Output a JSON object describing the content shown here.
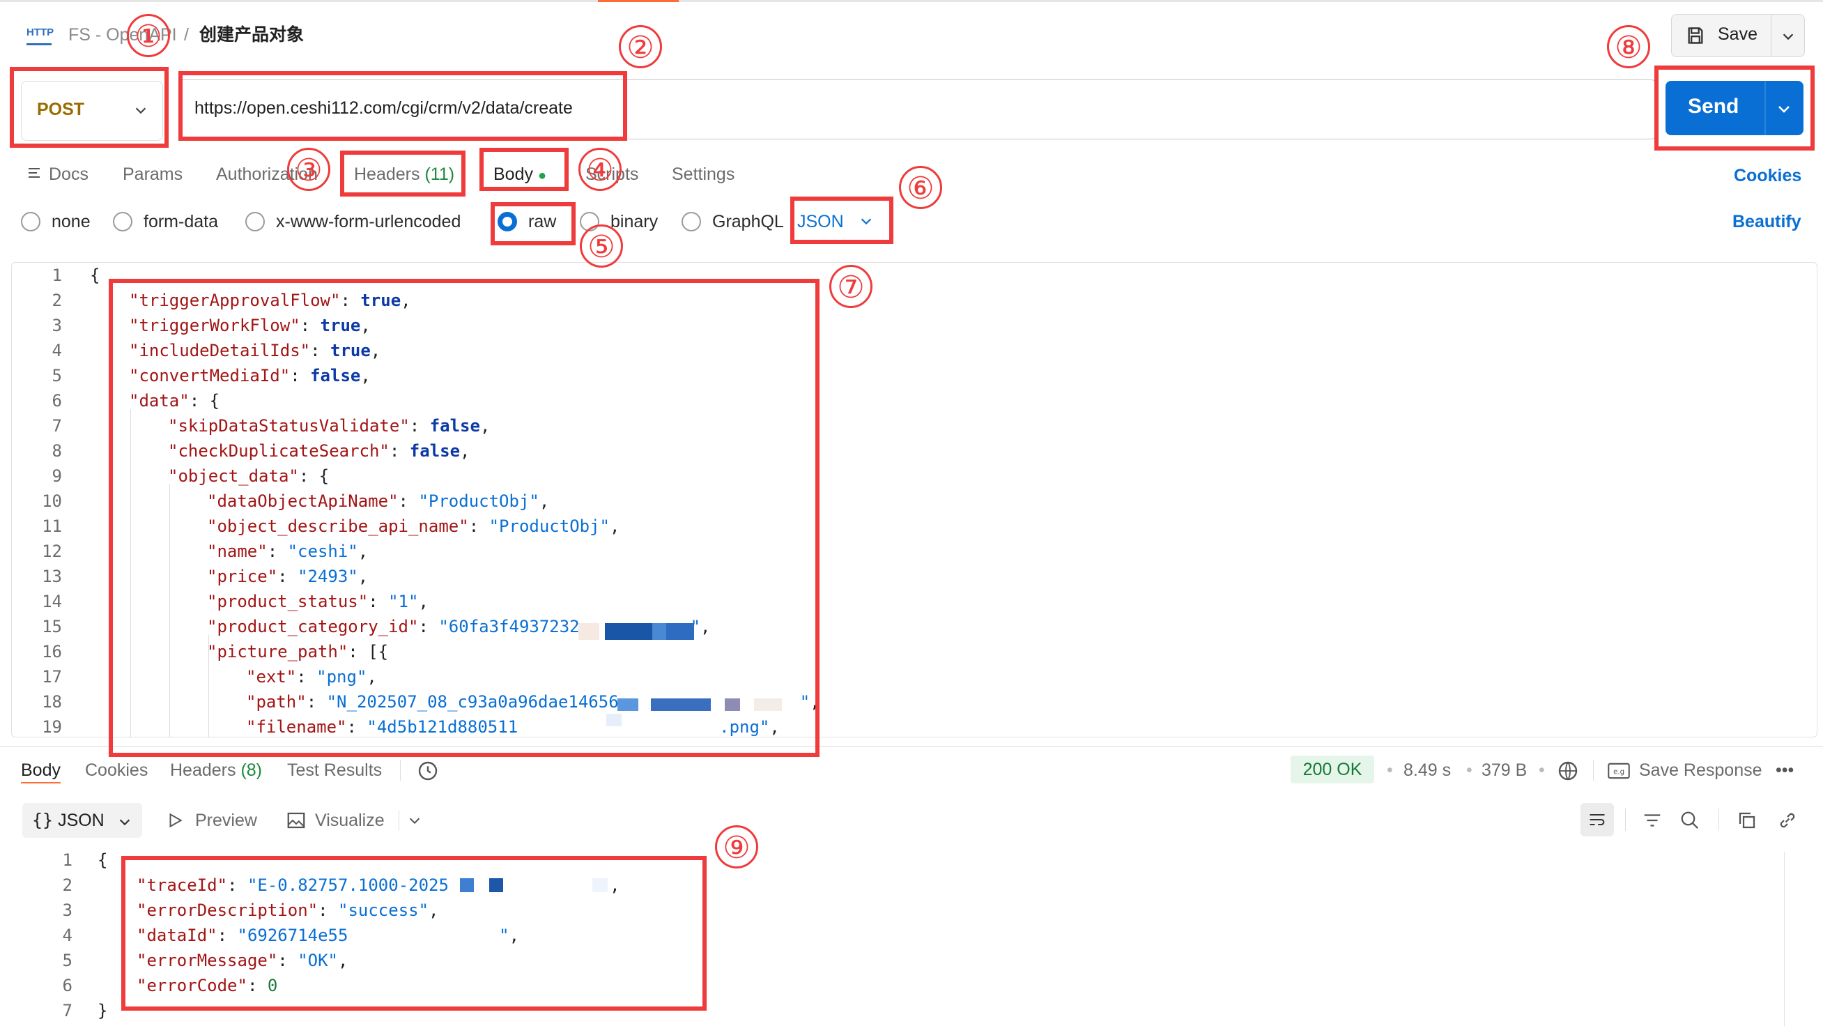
{
  "breadcrumb": {
    "collection": "FS - OpenAPI",
    "separator": "/",
    "request": "创建产品对象"
  },
  "toolbar": {
    "save_label": "Save"
  },
  "request": {
    "method": "POST",
    "url": "https://open.ceshi112.com/cgi/crm/v2/data/create",
    "send_label": "Send"
  },
  "tabs": {
    "docs": "Docs",
    "params": "Params",
    "authorization": "Authorization",
    "headers": "Headers",
    "headers_count": "(11)",
    "body": "Body",
    "scripts": "Scripts",
    "settings": "Settings",
    "cookies": "Cookies"
  },
  "body_modes": {
    "none": "none",
    "form_data": "form-data",
    "urlencoded": "x-www-form-urlencoded",
    "raw": "raw",
    "binary": "binary",
    "graphql": "GraphQL",
    "format": "JSON",
    "beautify": "Beautify"
  },
  "request_body_lines": [
    {
      "n": "1",
      "indent": 0,
      "t": [
        [
          "p",
          "{"
        ]
      ]
    },
    {
      "n": "2",
      "indent": 1,
      "t": [
        [
          "k",
          "\"triggerApprovalFlow\""
        ],
        [
          "p",
          ": "
        ],
        [
          "b",
          "true"
        ],
        [
          "p",
          ","
        ]
      ]
    },
    {
      "n": "3",
      "indent": 1,
      "t": [
        [
          "k",
          "\"triggerWorkFlow\""
        ],
        [
          "p",
          ": "
        ],
        [
          "b",
          "true"
        ],
        [
          "p",
          ","
        ]
      ]
    },
    {
      "n": "4",
      "indent": 1,
      "t": [
        [
          "k",
          "\"includeDetailIds\""
        ],
        [
          "p",
          ": "
        ],
        [
          "b",
          "true"
        ],
        [
          "p",
          ","
        ]
      ]
    },
    {
      "n": "5",
      "indent": 1,
      "t": [
        [
          "k",
          "\"convertMediaId\""
        ],
        [
          "p",
          ": "
        ],
        [
          "b",
          "false"
        ],
        [
          "p",
          ","
        ]
      ]
    },
    {
      "n": "6",
      "indent": 1,
      "t": [
        [
          "k",
          "\"data\""
        ],
        [
          "p",
          ": {"
        ]
      ]
    },
    {
      "n": "7",
      "indent": 2,
      "t": [
        [
          "k",
          "\"skipDataStatusValidate\""
        ],
        [
          "p",
          ": "
        ],
        [
          "b",
          "false"
        ],
        [
          "p",
          ","
        ]
      ]
    },
    {
      "n": "8",
      "indent": 2,
      "t": [
        [
          "k",
          "\"checkDuplicateSearch\""
        ],
        [
          "p",
          ": "
        ],
        [
          "b",
          "false"
        ],
        [
          "p",
          ","
        ]
      ]
    },
    {
      "n": "9",
      "indent": 2,
      "t": [
        [
          "k",
          "\"object_data\""
        ],
        [
          "p",
          ": {"
        ]
      ]
    },
    {
      "n": "10",
      "indent": 3,
      "t": [
        [
          "k",
          "\"dataObjectApiName\""
        ],
        [
          "p",
          ": "
        ],
        [
          "s",
          "\"ProductObj\""
        ],
        [
          "p",
          ","
        ]
      ]
    },
    {
      "n": "11",
      "indent": 3,
      "t": [
        [
          "k",
          "\"object_describe_api_name\""
        ],
        [
          "p",
          ": "
        ],
        [
          "s",
          "\"ProductObj\""
        ],
        [
          "p",
          ","
        ]
      ]
    },
    {
      "n": "12",
      "indent": 3,
      "t": [
        [
          "k",
          "\"name\""
        ],
        [
          "p",
          ": "
        ],
        [
          "s",
          "\"ceshi\""
        ],
        [
          "p",
          ","
        ]
      ]
    },
    {
      "n": "13",
      "indent": 3,
      "t": [
        [
          "k",
          "\"price\""
        ],
        [
          "p",
          ": "
        ],
        [
          "s",
          "\"2493\""
        ],
        [
          "p",
          ","
        ]
      ]
    },
    {
      "n": "14",
      "indent": 3,
      "t": [
        [
          "k",
          "\"product_status\""
        ],
        [
          "p",
          ": "
        ],
        [
          "s",
          "\"1\""
        ],
        [
          "p",
          ","
        ]
      ]
    },
    {
      "n": "15",
      "indent": 3,
      "t": [
        [
          "k",
          "\"product_category_id\""
        ],
        [
          "p",
          ": "
        ],
        [
          "s",
          "\"60fa3f4937232           \""
        ],
        [
          "p",
          ","
        ]
      ]
    },
    {
      "n": "16",
      "indent": 3,
      "t": [
        [
          "k",
          "\"picture_path\""
        ],
        [
          "p",
          ": [{"
        ]
      ]
    },
    {
      "n": "17",
      "indent": 4,
      "t": [
        [
          "k",
          "\"ext\""
        ],
        [
          "p",
          ": "
        ],
        [
          "s",
          "\"png\""
        ],
        [
          "p",
          ","
        ]
      ]
    },
    {
      "n": "18",
      "indent": 4,
      "t": [
        [
          "k",
          "\"path\""
        ],
        [
          "p",
          ": "
        ],
        [
          "s",
          "\"N_202507_08_c93a0a96dae14656                  \""
        ],
        [
          "p",
          ","
        ]
      ]
    },
    {
      "n": "19",
      "indent": 4,
      "t": [
        [
          "k",
          "\"filename\""
        ],
        [
          "p",
          ": "
        ],
        [
          "s",
          "\"4d5b121d880511                    .png\""
        ],
        [
          "p",
          ","
        ]
      ]
    }
  ],
  "response_tabs": {
    "body": "Body",
    "cookies": "Cookies",
    "headers": "Headers",
    "headers_count": "(8)",
    "test_results": "Test Results"
  },
  "response_meta": {
    "status": "200 OK",
    "time": "8.49 s",
    "size": "379 B",
    "save_response": "Save Response"
  },
  "response_view": {
    "format": "JSON",
    "preview": "Preview",
    "visualize": "Visualize"
  },
  "response_body_lines": [
    {
      "n": "1",
      "indent": 0,
      "t": [
        [
          "p",
          "{"
        ]
      ]
    },
    {
      "n": "2",
      "indent": 1,
      "t": [
        [
          "k",
          "\"traceId\""
        ],
        [
          "p",
          ": "
        ],
        [
          "s",
          "\"E-0.82757.1000-2025               \""
        ],
        [
          "p",
          ","
        ]
      ]
    },
    {
      "n": "3",
      "indent": 1,
      "t": [
        [
          "k",
          "\"errorDescription\""
        ],
        [
          "p",
          ": "
        ],
        [
          "s",
          "\"success\""
        ],
        [
          "p",
          ","
        ]
      ]
    },
    {
      "n": "4",
      "indent": 1,
      "t": [
        [
          "k",
          "\"dataId\""
        ],
        [
          "p",
          ": "
        ],
        [
          "s",
          "\"6926714e55               \""
        ],
        [
          "p",
          ","
        ]
      ]
    },
    {
      "n": "5",
      "indent": 1,
      "t": [
        [
          "k",
          "\"errorMessage\""
        ],
        [
          "p",
          ": "
        ],
        [
          "s",
          "\"OK\""
        ],
        [
          "p",
          ","
        ]
      ]
    },
    {
      "n": "6",
      "indent": 1,
      "t": [
        [
          "k",
          "\"errorCode\""
        ],
        [
          "p",
          ": "
        ],
        [
          "n",
          "0"
        ]
      ]
    },
    {
      "n": "7",
      "indent": 0,
      "t": [
        [
          "p",
          "}"
        ]
      ]
    }
  ],
  "annotations": [
    "①",
    "②",
    "③",
    "④",
    "⑤",
    "⑥",
    "⑦",
    "⑧",
    "⑨"
  ],
  "colors": {
    "accent": "#0a6fd4",
    "annotation": "#ef3b3b",
    "method": "#9a6b00",
    "ok_green": "#147a34"
  }
}
